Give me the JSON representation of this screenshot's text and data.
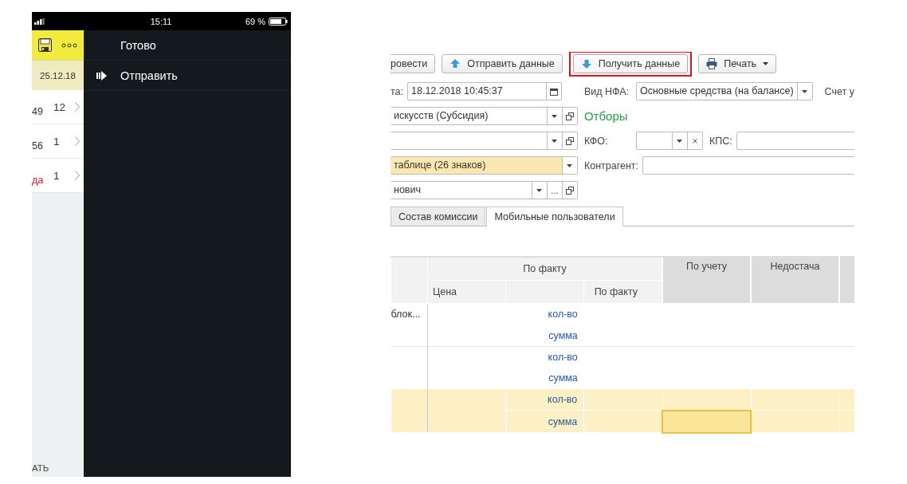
{
  "phone": {
    "status_bar": {
      "time": "15:11",
      "battery": "69 %"
    },
    "side_list": {
      "date": "25.12.18",
      "rows": [
        {
          "label": "49",
          "count": "12",
          "color": "#333333"
        },
        {
          "label": "56",
          "count": "1",
          "color": "#333333"
        },
        {
          "label": "да",
          "count": "1",
          "color": "#e0203a"
        }
      ],
      "footer": "АТЬ"
    },
    "menu": [
      {
        "label": "Готово",
        "kind": "plain"
      },
      {
        "label": "Отправить",
        "kind": "send"
      }
    ]
  },
  "form": {
    "toolbar": [
      {
        "label": "ровести",
        "kind": "plain",
        "highlighted": false,
        "dropdown": false
      },
      {
        "label": "Отправить данные",
        "kind": "send",
        "highlighted": false,
        "dropdown": false
      },
      {
        "label": "Получить данные",
        "kind": "receive",
        "highlighted": true,
        "dropdown": false
      },
      {
        "label": "Печать",
        "kind": "print",
        "highlighted": false,
        "dropdown": true
      }
    ],
    "left_fields": [
      {
        "label": "та:",
        "value": "18.12.2018 10:45:37",
        "highlighted": false,
        "buttons": [
          {
            "kind": "calendar"
          }
        ]
      },
      {
        "value": "искусств (Субсидия)",
        "highlighted": false,
        "buttons": [
          {
            "kind": "dropdown"
          },
          {
            "kind": "open"
          }
        ]
      },
      {
        "highlighted": false,
        "buttons": [
          {
            "kind": "dropdown"
          },
          {
            "kind": "open"
          }
        ]
      },
      {
        "value": "таблице (26 знаков)",
        "highlighted": true,
        "buttons": [
          {
            "kind": "dropdown"
          }
        ]
      },
      {
        "value": "нович",
        "highlighted": false,
        "buttons": [
          {
            "kind": "dropdown"
          },
          {
            "kind": "select",
            "label": "..."
          },
          {
            "kind": "open"
          }
        ]
      }
    ],
    "right": {
      "nfa_label": "Вид НФА:",
      "nfa_value": "Основные средства (на балансе)",
      "account_label": "Счет у",
      "filters_title": "Отборы",
      "kfo_label": "КФО:",
      "kps_label": "КПС:",
      "counterparty_label": "Контрагент:"
    },
    "tabs": [
      {
        "label": "Состав комиссии",
        "selected": false
      },
      {
        "label": "Мобильные пользователи",
        "selected": true
      }
    ],
    "table": {
      "group_header": "По факту",
      "columns": [
        "Цена",
        "",
        "По факту"
      ],
      "account_column": "По учету",
      "shortage_column": "Недостача",
      "rows": [
        {
          "label": "блок...",
          "selected": false,
          "lines": [
            {
              "measure": "кол-во",
              "cell_selected": false
            },
            {
              "measure": "сумма",
              "cell_selected": false
            }
          ]
        },
        {
          "label": "",
          "selected": false,
          "lines": [
            {
              "measure": "кол-во",
              "cell_selected": false
            },
            {
              "measure": "сумма",
              "cell_selected": false
            }
          ]
        },
        {
          "label": "",
          "selected": true,
          "lines": [
            {
              "measure": "кол-во",
              "cell_selected": false
            },
            {
              "measure": "сумма",
              "cell_selected": true
            }
          ]
        }
      ]
    }
  }
}
